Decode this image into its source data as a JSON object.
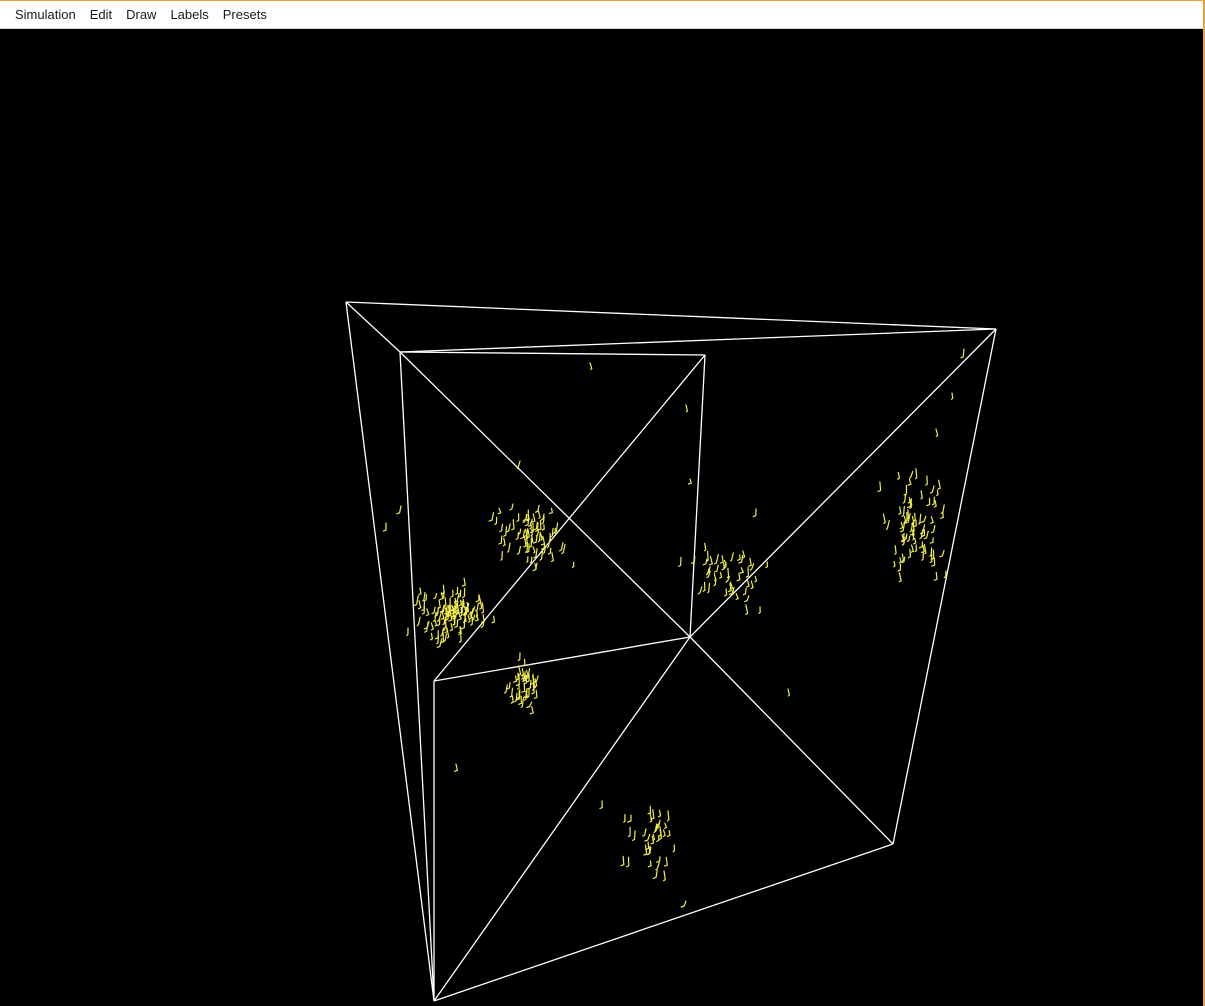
{
  "menubar": {
    "items": [
      {
        "id": "simulation",
        "label": "Simulation"
      },
      {
        "id": "edit",
        "label": "Edit"
      },
      {
        "id": "draw",
        "label": "Draw"
      },
      {
        "id": "labels",
        "label": "Labels"
      },
      {
        "id": "presets",
        "label": "Presets"
      }
    ]
  },
  "colors": {
    "background": "#000000",
    "wireframe": "#ffffff",
    "particles": "#f2ee4a",
    "window_border": "#e8a23c",
    "menubar_bg": "#ffffff"
  }
}
